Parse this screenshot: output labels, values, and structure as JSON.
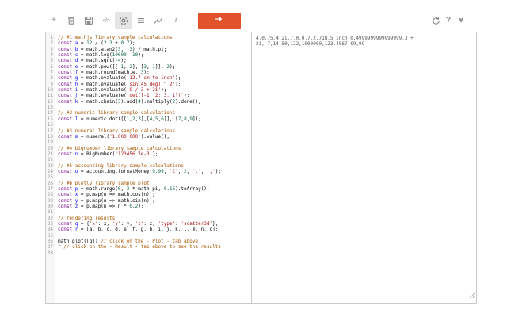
{
  "toolbar": {
    "left": [
      {
        "name": "new",
        "icon": "plus-icon",
        "glyph": "+"
      },
      {
        "name": "delete",
        "icon": "trash-icon"
      },
      {
        "name": "save",
        "icon": "save-icon"
      },
      {
        "name": "code",
        "icon": "code-icon",
        "glyph": "</>"
      },
      {
        "name": "settings",
        "icon": "gear-icon",
        "active": true
      },
      {
        "name": "results",
        "icon": "list-icon"
      },
      {
        "name": "plot",
        "icon": "chart-icon"
      },
      {
        "name": "info",
        "icon": "info-icon",
        "glyph": "i"
      },
      {
        "name": "run",
        "icon": "run-icon"
      }
    ],
    "right": [
      {
        "name": "refresh",
        "icon": "refresh-icon"
      },
      {
        "name": "help",
        "icon": "question-icon",
        "glyph": "?"
      },
      {
        "name": "favorite",
        "icon": "heart-icon",
        "glyph": "♥"
      }
    ]
  },
  "editor": {
    "lines": [
      [
        [
          "c",
          "// #1 mathjs library sample calculations"
        ]
      ],
      [
        [
          "k",
          "const"
        ],
        [
          "p",
          " "
        ],
        [
          "d",
          "a"
        ],
        [
          "p",
          " = "
        ],
        [
          "n",
          "12"
        ],
        [
          "p",
          " / ("
        ],
        [
          "n",
          "2.3"
        ],
        [
          "p",
          " + "
        ],
        [
          "n",
          "0.7"
        ],
        [
          "p",
          ");"
        ]
      ],
      [
        [
          "k",
          "const"
        ],
        [
          "p",
          " "
        ],
        [
          "d",
          "b"
        ],
        [
          "p",
          " = math.atan2("
        ],
        [
          "n",
          "3"
        ],
        [
          "p",
          ", -"
        ],
        [
          "n",
          "3"
        ],
        [
          "p",
          ") / math.pi;"
        ]
      ],
      [
        [
          "k",
          "const"
        ],
        [
          "p",
          " "
        ],
        [
          "d",
          "c"
        ],
        [
          "p",
          " = math.log("
        ],
        [
          "n",
          "10000"
        ],
        [
          "p",
          ", "
        ],
        [
          "n",
          "10"
        ],
        [
          "p",
          ");"
        ]
      ],
      [
        [
          "k",
          "const"
        ],
        [
          "p",
          " "
        ],
        [
          "d",
          "d"
        ],
        [
          "p",
          " = math.sqrt(-"
        ],
        [
          "n",
          "4"
        ],
        [
          "p",
          ");"
        ]
      ],
      [
        [
          "k",
          "const"
        ],
        [
          "p",
          " "
        ],
        [
          "d",
          "e"
        ],
        [
          "p",
          " = math.pow([[-"
        ],
        [
          "n",
          "1"
        ],
        [
          "p",
          ", "
        ],
        [
          "n",
          "2"
        ],
        [
          "p",
          "], ["
        ],
        [
          "n",
          "3"
        ],
        [
          "p",
          ", "
        ],
        [
          "n",
          "1"
        ],
        [
          "p",
          "]], "
        ],
        [
          "n",
          "2"
        ],
        [
          "p",
          ");"
        ]
      ],
      [
        [
          "k",
          "const"
        ],
        [
          "p",
          " "
        ],
        [
          "d",
          "f"
        ],
        [
          "p",
          " = math.round(math.e, "
        ],
        [
          "n",
          "3"
        ],
        [
          "p",
          ");"
        ]
      ],
      [
        [
          "k",
          "const"
        ],
        [
          "p",
          " "
        ],
        [
          "d",
          "g"
        ],
        [
          "p",
          " = math.evaluate("
        ],
        [
          "s",
          "'12.7 cm to inch'"
        ],
        [
          "p",
          ");"
        ]
      ],
      [
        [
          "k",
          "const"
        ],
        [
          "p",
          " "
        ],
        [
          "d",
          "h"
        ],
        [
          "p",
          " = math.evaluate("
        ],
        [
          "s",
          "'sin(45 deg) ^ 2'"
        ],
        [
          "p",
          ");"
        ]
      ],
      [
        [
          "k",
          "const"
        ],
        [
          "p",
          " "
        ],
        [
          "d",
          "i"
        ],
        [
          "p",
          " = math.evaluate("
        ],
        [
          "s",
          "'9 / 3 + 2i'"
        ],
        [
          "p",
          ");"
        ]
      ],
      [
        [
          "k",
          "const"
        ],
        [
          "p",
          " "
        ],
        [
          "d",
          "j"
        ],
        [
          "p",
          " = math.evaluate("
        ],
        [
          "s",
          "'det([-1, 2; 3, 1])'"
        ],
        [
          "p",
          ");"
        ]
      ],
      [
        [
          "k",
          "const"
        ],
        [
          "p",
          " "
        ],
        [
          "d",
          "k"
        ],
        [
          "p",
          " = math.chain("
        ],
        [
          "n",
          "3"
        ],
        [
          "p",
          ").add("
        ],
        [
          "n",
          "4"
        ],
        [
          "p",
          ").multiply("
        ],
        [
          "n",
          "2"
        ],
        [
          "p",
          ").done();"
        ]
      ],
      [],
      [
        [
          "c",
          "// #2 numeric library sample calculations"
        ]
      ],
      [
        [
          "k",
          "const"
        ],
        [
          "p",
          " "
        ],
        [
          "d",
          "l"
        ],
        [
          "p",
          " = numeric.dot([["
        ],
        [
          "n",
          "1"
        ],
        [
          "p",
          ","
        ],
        [
          "n",
          "2"
        ],
        [
          "p",
          ","
        ],
        [
          "n",
          "3"
        ],
        [
          "p",
          "],["
        ],
        [
          "n",
          "4"
        ],
        [
          "p",
          ","
        ],
        [
          "n",
          "5"
        ],
        [
          "p",
          ","
        ],
        [
          "n",
          "6"
        ],
        [
          "p",
          "]], ["
        ],
        [
          "n",
          "7"
        ],
        [
          "p",
          ","
        ],
        [
          "n",
          "8"
        ],
        [
          "p",
          ","
        ],
        [
          "n",
          "9"
        ],
        [
          "p",
          "]);"
        ]
      ],
      [],
      [
        [
          "c",
          "// #3 numeral library sample calculations"
        ]
      ],
      [
        [
          "k",
          "const"
        ],
        [
          "p",
          " "
        ],
        [
          "d",
          "m"
        ],
        [
          "p",
          " = numeral("
        ],
        [
          "s",
          "'1,000,000'"
        ],
        [
          "p",
          ").value();"
        ]
      ],
      [],
      [
        [
          "c",
          "// #4 bignumber library sample calculations"
        ]
      ],
      [
        [
          "k",
          "const"
        ],
        [
          "p",
          " "
        ],
        [
          "d",
          "n"
        ],
        [
          "p",
          " = BigNumber("
        ],
        [
          "s",
          "'123456.7e-3'"
        ],
        [
          "p",
          ");"
        ]
      ],
      [],
      [
        [
          "c",
          "// #5 accounting library sample calculations"
        ]
      ],
      [
        [
          "k",
          "const"
        ],
        [
          "p",
          " "
        ],
        [
          "d",
          "o"
        ],
        [
          "p",
          " = accounting.formatMoney("
        ],
        [
          "n",
          "9.99"
        ],
        [
          "p",
          ", "
        ],
        [
          "s",
          "'€'"
        ],
        [
          "p",
          ", "
        ],
        [
          "n",
          "2"
        ],
        [
          "p",
          ", "
        ],
        [
          "s",
          "'.'"
        ],
        [
          "p",
          ", "
        ],
        [
          "s",
          "','"
        ],
        [
          "p",
          ");"
        ]
      ],
      [],
      [
        [
          "c",
          "// #6 plotly library sample plot"
        ]
      ],
      [
        [
          "k",
          "const"
        ],
        [
          "p",
          " "
        ],
        [
          "d",
          "p"
        ],
        [
          "p",
          " = math.range("
        ],
        [
          "n",
          "0"
        ],
        [
          "p",
          ", "
        ],
        [
          "n",
          "3"
        ],
        [
          "p",
          " * math.pi, "
        ],
        [
          "n",
          "0.15"
        ],
        [
          "p",
          ").toArray();"
        ]
      ],
      [
        [
          "k",
          "const"
        ],
        [
          "p",
          " "
        ],
        [
          "d",
          "x"
        ],
        [
          "p",
          " = p.map(n => math.cos(n));"
        ]
      ],
      [
        [
          "k",
          "const"
        ],
        [
          "p",
          " "
        ],
        [
          "d",
          "y"
        ],
        [
          "p",
          " = p.map(n => math.sin(n));"
        ]
      ],
      [
        [
          "k",
          "const"
        ],
        [
          "p",
          " "
        ],
        [
          "d",
          "z"
        ],
        [
          "p",
          " = p.map(n => n * "
        ],
        [
          "n",
          "0.2"
        ],
        [
          "p",
          ");"
        ]
      ],
      [],
      [
        [
          "c",
          "// rendering results"
        ]
      ],
      [
        [
          "k",
          "const"
        ],
        [
          "p",
          " "
        ],
        [
          "d",
          "q"
        ],
        [
          "p",
          " = {"
        ],
        [
          "s",
          "'x'"
        ],
        [
          "p",
          ": x, "
        ],
        [
          "s",
          "'y'"
        ],
        [
          "p",
          ": y, "
        ],
        [
          "s",
          "'z'"
        ],
        [
          "p",
          ": z, "
        ],
        [
          "s",
          "'type'"
        ],
        [
          "p",
          ": "
        ],
        [
          "s",
          "'scatter3d'"
        ],
        [
          "p",
          "};"
        ]
      ],
      [
        [
          "k",
          "const"
        ],
        [
          "p",
          " "
        ],
        [
          "d",
          "r"
        ],
        [
          "p",
          " = [a, b, c, d, e, f, g, h, i, j, k, l, m, n, o];"
        ]
      ],
      [],
      [
        [
          "p",
          "math.plot([q]) "
        ],
        [
          "c",
          "// click on the - Plot - tab above"
        ]
      ],
      [
        [
          "p",
          "r "
        ],
        [
          "c",
          "// click on the - Result - tab above to see the results"
        ]
      ],
      []
    ]
  },
  "output": {
    "text": "4,0.75,4,2i,7,0,0,7,2.718,5 inch,0.4999999999999999,3 + 2i,-7,14,50,122,1000000,123.4567,€9,99"
  },
  "colors": {
    "accent": "#e2532c",
    "comment": "#aa5500",
    "keyword": "#770088",
    "definition": "#0000ff",
    "number": "#116644",
    "string": "#aa1111",
    "line_number": "#999999",
    "toolbar_icon": "#8b8b8b",
    "panel_border": "#c9c9c9"
  }
}
